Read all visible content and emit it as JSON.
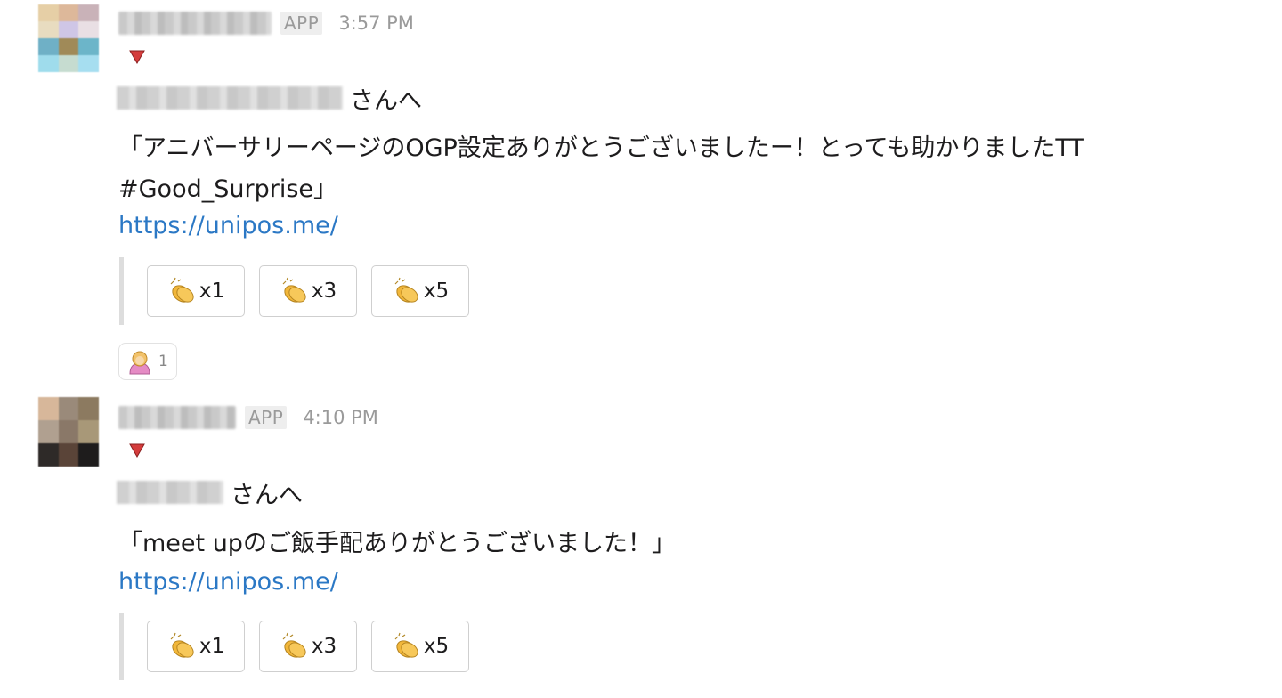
{
  "messages": [
    {
      "app_badge": "APP",
      "time": "3:57 PM",
      "recipient_suffix": "さんへ",
      "body": "「アニバーサリーページのOGP設定ありがとうございましたー！とっても助かりましたTT\n#Good_Surprise」",
      "link": "https://unipos.me/",
      "buttons": [
        {
          "label": "x1",
          "icon": "clapping-hands-icon"
        },
        {
          "label": "x3",
          "icon": "clapping-hands-icon"
        },
        {
          "label": "x5",
          "icon": "clapping-hands-icon"
        }
      ],
      "reaction": {
        "icon": "person-bowing-icon",
        "count": "1"
      }
    },
    {
      "app_badge": "APP",
      "time": "4:10 PM",
      "recipient_suffix": "さんへ",
      "body": "「meet upのご飯手配ありがとうございました！」",
      "link": "https://unipos.me/",
      "buttons": [
        {
          "label": "x1",
          "icon": "clapping-hands-icon"
        },
        {
          "label": "x3",
          "icon": "clapping-hands-icon"
        },
        {
          "label": "x5",
          "icon": "clapping-hands-icon"
        }
      ]
    }
  ],
  "colors": {
    "link": "#2b78c5",
    "badge_text": "#9a9a9a",
    "triangle": "#d43c3c",
    "clap": "#f2b73a"
  }
}
